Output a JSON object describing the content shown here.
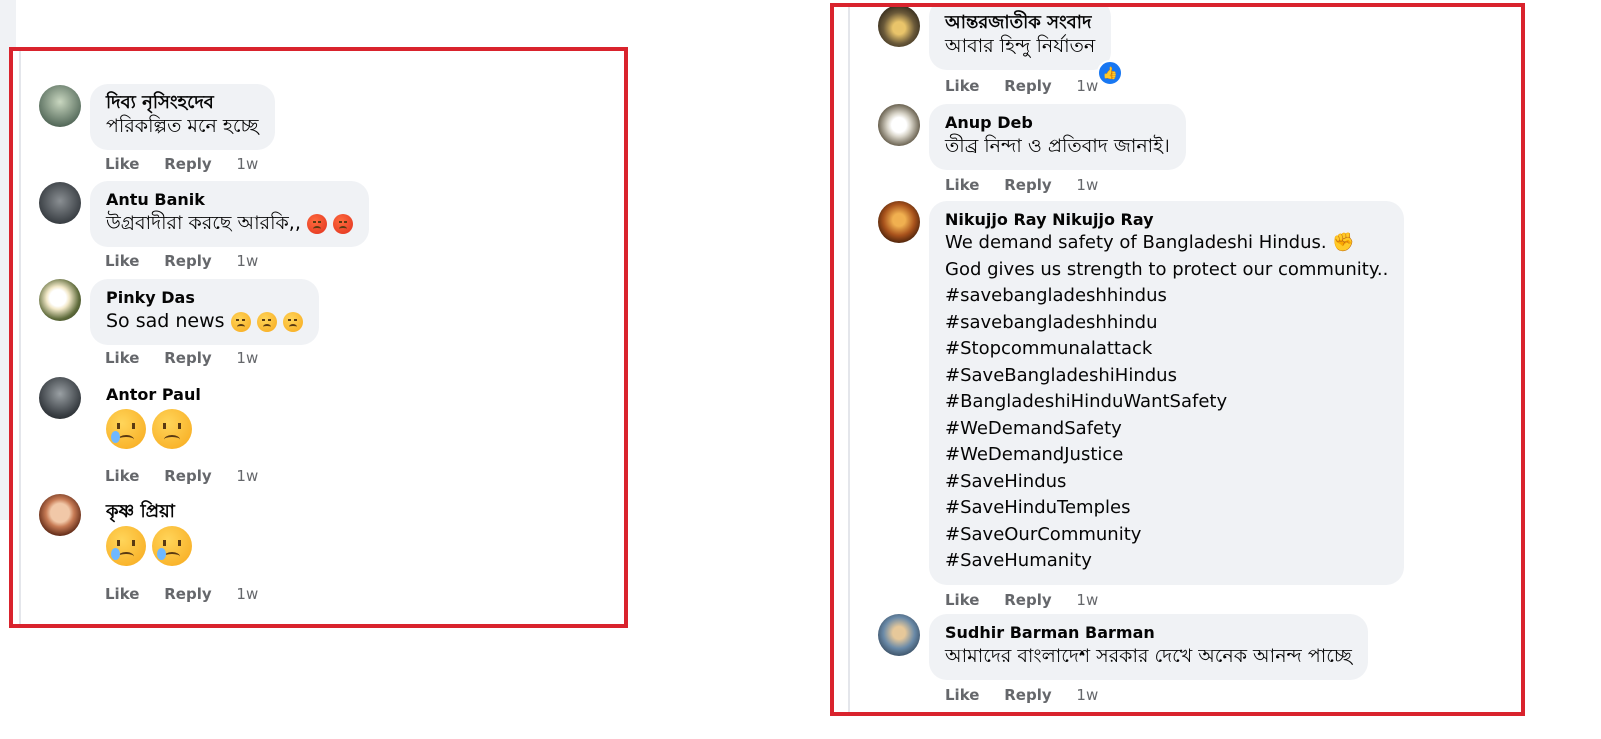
{
  "left_panel": {
    "comments": [
      {
        "author": "দিব্য নৃসিংহদেব",
        "text": "পরিকল্পিত মনে হচ্ছে",
        "like": "Like",
        "reply": "Reply",
        "time": "1w"
      },
      {
        "author": "Antu Banik",
        "text": "উগ্রবাদীরা করছে আরকি,,",
        "emoji": [
          "angry-face-emoji",
          "angry-face-emoji"
        ],
        "like": "Like",
        "reply": "Reply",
        "time": "1w"
      },
      {
        "author": "Pinky Das",
        "text": "So sad news",
        "emoji": [
          "sad-face-emoji",
          "sad-face-emoji",
          "sad-face-emoji"
        ],
        "like": "Like",
        "reply": "Reply",
        "time": "1w"
      },
      {
        "author": "Antor Paul",
        "emoji": [
          "sad-face-emoji",
          "sad-face-emoji"
        ],
        "like": "Like",
        "reply": "Reply",
        "time": "1w"
      },
      {
        "author": "কৃষ্ণ প্রিয়া",
        "emoji": [
          "crying-face-emoji",
          "crying-face-emoji"
        ],
        "like": "Like",
        "reply": "Reply",
        "time": "1w"
      }
    ]
  },
  "right_panel": {
    "comments": [
      {
        "author": "আন্তরজাতীক সংবাদ",
        "text": "আবার হিন্দু নির্যাতন",
        "like": "Like",
        "reply": "Reply",
        "time": "1w",
        "reaction": "like-reaction-icon"
      },
      {
        "author": "Anup Deb",
        "text": "তীব্র নিন্দা ও প্রতিবাদ জানাই।",
        "like": "Like",
        "reply": "Reply",
        "time": "1w"
      },
      {
        "author": "Nikujjo Ray Nikujjo Ray",
        "lines": [
          "We demand safety of Bangladeshi Hindus. ✊",
          "God gives us strength to protect our community..",
          "#savebangladeshhindus",
          "#savebangladeshhindu",
          "#Stopcommunalattack",
          "#SaveBangladeshiHindus",
          "#BangladeshiHinduWantSafety",
          "#WeDemandSafety",
          "#WeDemandJustice",
          "#SaveHindus",
          "#SaveHinduTemples",
          "#SaveOurCommunity",
          "#SaveHumanity"
        ],
        "like": "Like",
        "reply": "Reply",
        "time": "1w"
      },
      {
        "author": "Sudhir Barman Barman",
        "text": "আমাদের বাংলাদেশ সরকার দেখে অনেক আনন্দ পাচ্ছে",
        "like": "Like",
        "reply": "Reply",
        "time": "1w"
      }
    ]
  },
  "colors": {
    "highlight_border": "#d9232d",
    "bubble_bg": "#f0f2f5",
    "meta_text": "#65676b",
    "like_reaction": "#1877f2"
  }
}
